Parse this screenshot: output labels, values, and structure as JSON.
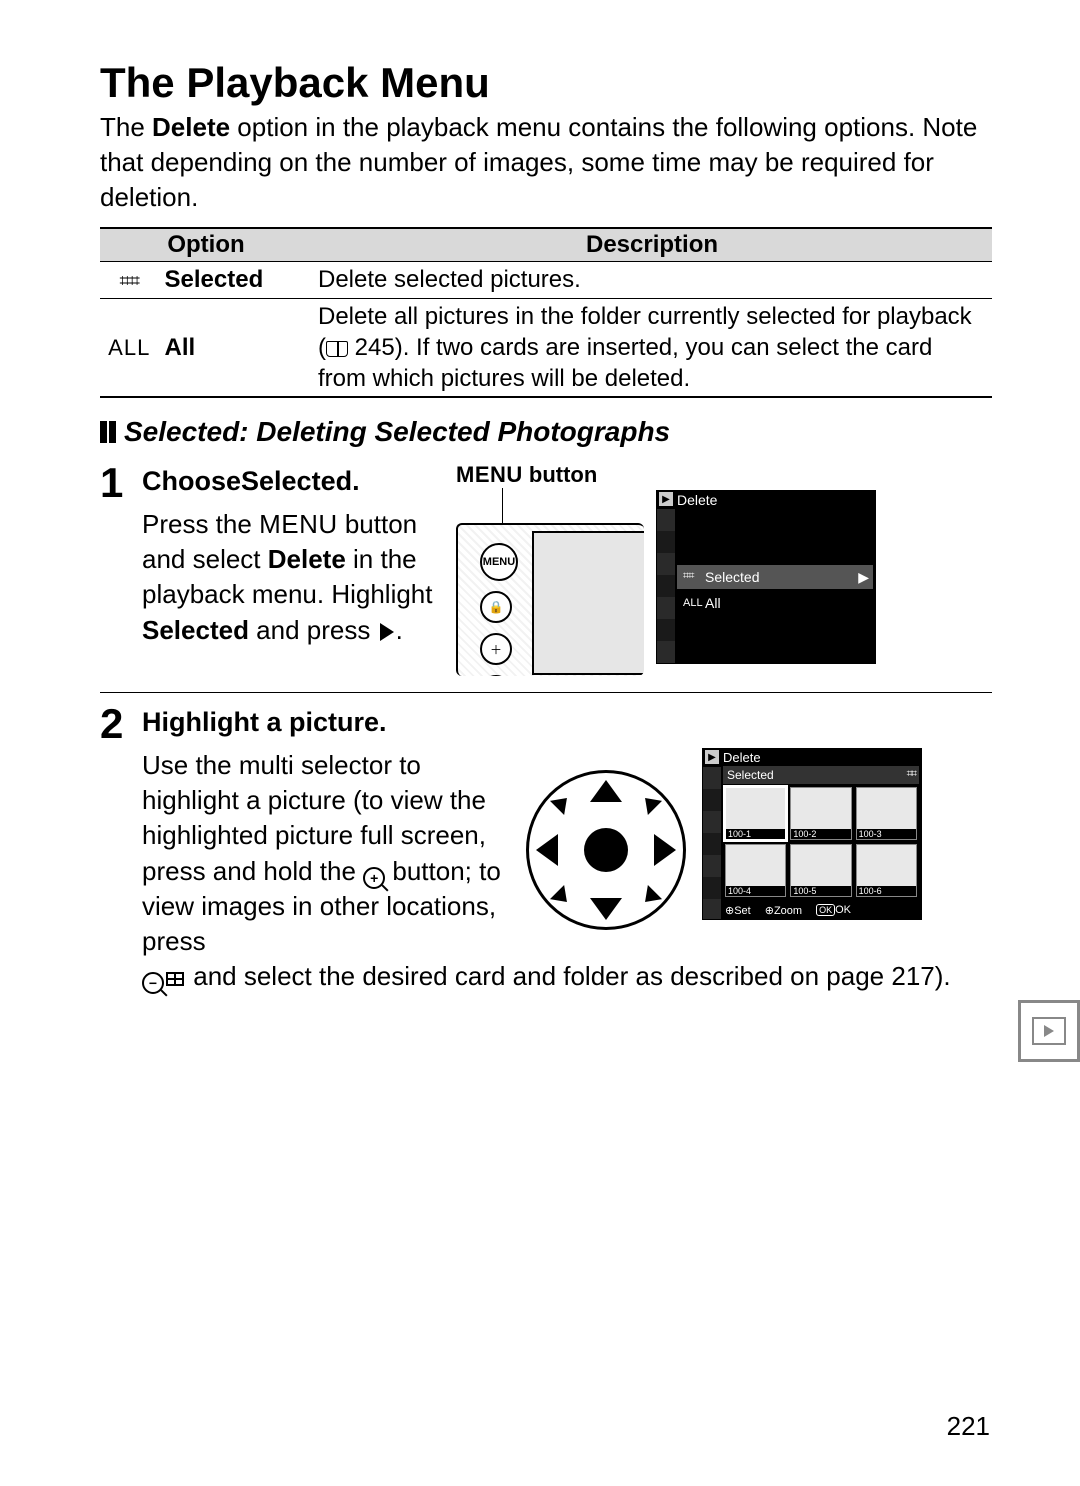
{
  "title": "The Playback Menu",
  "intro_parts": {
    "p1": "The ",
    "b1": "Delete",
    "p2": " option in the playback menu contains the following options.  Note that depending on the number of images, some time may be required for deletion."
  },
  "table": {
    "head_option": "Option",
    "head_desc": "Description",
    "rows": [
      {
        "icon": "⌗⌗",
        "label": "Selected",
        "desc": "Delete selected pictures."
      },
      {
        "icon": "ALL",
        "label": "All",
        "desc_parts": {
          "p1": "Delete all pictures in the folder currently selected for playback (",
          "ref": " 245). If two cards are inserted, you can select the card from which pictures will be deleted."
        }
      }
    ]
  },
  "section_title": "Selected: Deleting Selected Photographs",
  "steps": [
    {
      "num": "1",
      "head_pre": "Choose ",
      "head_bold": "Selected",
      "head_post": ".",
      "menu_button_label": "MENU",
      "menu_button_suffix": " button",
      "para": {
        "p1": "Press the ",
        "menu": "MENU",
        "p2": " button and select ",
        "b1": "Delete",
        "p3": " in the playback menu.  Highlight ",
        "b2": "Selected",
        "p4": " and press "
      },
      "lcd": {
        "title": "Delete",
        "row_sel_label": "Selected",
        "row_all_icon": "ALL",
        "row_all_label": "All"
      }
    },
    {
      "num": "2",
      "head": "Highlight a picture.",
      "para": {
        "p1": "Use the multi selector to highlight a picture (to view the highlighted picture full screen, press and hold the ",
        "p2": " button; to view images in other locations, press ",
        "p3": " and select the desired card and folder as described on page 217)."
      },
      "lcd": {
        "title": "Delete",
        "sub": "Selected",
        "thumbs": [
          "100-1",
          "100-2",
          "100-3",
          "100-4",
          "100-5",
          "100-6"
        ],
        "bottom_set": "Set",
        "bottom_zoom": "Zoom",
        "bottom_ok_k": "OK",
        "bottom_ok": "OK"
      }
    }
  ],
  "page_number": "221"
}
